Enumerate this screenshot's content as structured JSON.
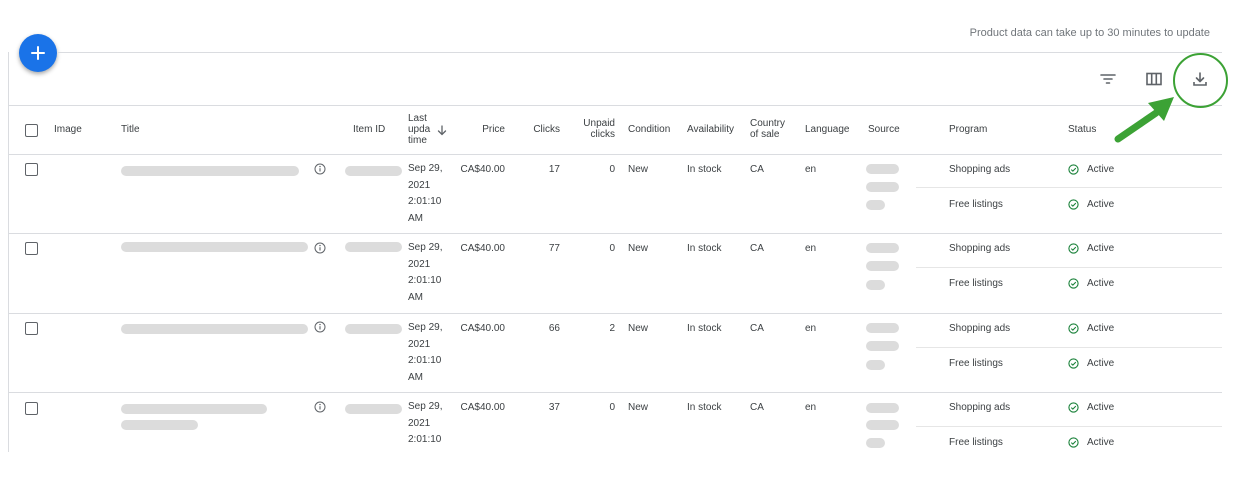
{
  "notice": "Product data can take up to 30 minutes to update",
  "icons": {
    "add": "plus-icon",
    "filter": "filter-icon",
    "columns": "columns-icon",
    "download": "download-icon",
    "info": "info-icon",
    "status": "check-circle-icon",
    "sort": "arrow-down-icon"
  },
  "colors": {
    "fab": "#1a73e8",
    "highlight": "#3ca235",
    "status_check": "#188038",
    "divider": "#dadce0"
  },
  "headers": {
    "image": "Image",
    "title": "Title",
    "item_id": "Item ID",
    "last_update": [
      "Last",
      "upda",
      "time"
    ],
    "price": "Price",
    "clicks": "Clicks",
    "unpaid_clicks": [
      "Unpaid",
      "clicks"
    ],
    "condition": "Condition",
    "availability": "Availability",
    "country": [
      "Country",
      "of sale"
    ],
    "language": "Language",
    "source": "Source",
    "program": "Program",
    "status": "Status"
  },
  "rows": [
    {
      "date": [
        "Sep 29,",
        "2021",
        "2:01:10",
        "AM"
      ],
      "price": "CA$40.00",
      "clicks": "17",
      "unpaid": "0",
      "condition": "New",
      "availability": "In stock",
      "country": "CA",
      "language": "en",
      "programs": [
        {
          "name": "Shopping ads",
          "status": "Active"
        },
        {
          "name": "Free listings",
          "status": "Active"
        }
      ]
    },
    {
      "date": [
        "Sep 29,",
        "2021",
        "2:01:10",
        "AM"
      ],
      "price": "CA$40.00",
      "clicks": "77",
      "unpaid": "0",
      "condition": "New",
      "availability": "In stock",
      "country": "CA",
      "language": "en",
      "programs": [
        {
          "name": "Shopping ads",
          "status": "Active"
        },
        {
          "name": "Free listings",
          "status": "Active"
        }
      ]
    },
    {
      "date": [
        "Sep 29,",
        "2021",
        "2:01:10",
        "AM"
      ],
      "price": "CA$40.00",
      "clicks": "66",
      "unpaid": "2",
      "condition": "New",
      "availability": "In stock",
      "country": "CA",
      "language": "en",
      "programs": [
        {
          "name": "Shopping ads",
          "status": "Active"
        },
        {
          "name": "Free listings",
          "status": "Active"
        }
      ]
    },
    {
      "date": [
        "Sep 29,",
        "2021",
        "2:01:10"
      ],
      "price": "CA$40.00",
      "clicks": "37",
      "unpaid": "0",
      "condition": "New",
      "availability": "In stock",
      "country": "CA",
      "language": "en",
      "programs": [
        {
          "name": "Shopping ads",
          "status": "Active"
        },
        {
          "name": "Free listings",
          "status": "Active"
        }
      ]
    }
  ]
}
